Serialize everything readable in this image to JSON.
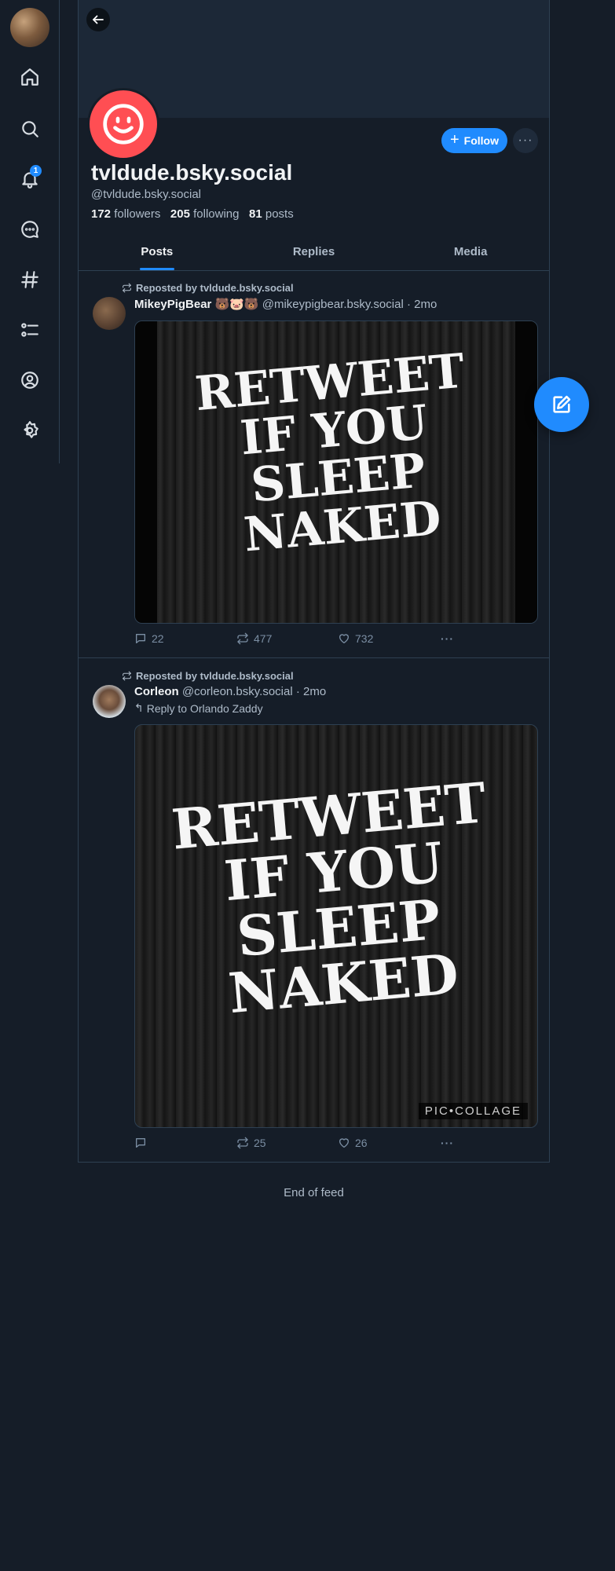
{
  "colors": {
    "background": "#151d28",
    "accent": "#208bfe",
    "avatar": "#ff4e53",
    "border": "#2e4052"
  },
  "nav": {
    "items": [
      {
        "icon": "home-icon"
      },
      {
        "icon": "search-icon"
      },
      {
        "icon": "notifications-icon",
        "badge": "1"
      },
      {
        "icon": "chat-icon"
      },
      {
        "icon": "feeds-hash-icon"
      },
      {
        "icon": "lists-icon"
      },
      {
        "icon": "profile-icon"
      },
      {
        "icon": "settings-icon"
      }
    ]
  },
  "profile": {
    "display_name": "tvldude.bsky.social",
    "handle": "@tvldude.bsky.social",
    "followers_count": "172",
    "followers_label": "followers",
    "following_count": "205",
    "following_label": "following",
    "posts_count": "81",
    "posts_label": "posts",
    "follow_label": "Follow",
    "more_label": "···"
  },
  "tabs": [
    {
      "label": "Posts",
      "active": true
    },
    {
      "label": "Replies",
      "active": false
    },
    {
      "label": "Media",
      "active": false
    }
  ],
  "posts": [
    {
      "repost_label": "Reposted by tvldude.bsky.social",
      "author": "MikeyPigBear 🐻🐷🐻",
      "handle": "@mikeypigbear.bsky.social",
      "time": "2mo",
      "image_text": [
        "RETWEET",
        "IF YOU",
        "SLEEP",
        "NAKED"
      ],
      "replies": "22",
      "reposts": "477",
      "likes": "732"
    },
    {
      "repost_label": "Reposted by tvldude.bsky.social",
      "author": "Corleon",
      "handle": "@corleon.bsky.social",
      "time": "2mo",
      "reply_to": "Reply to Orlando Zaddy",
      "image_text": [
        "RETWEET",
        "IF YOU",
        "SLEEP",
        "NAKED"
      ],
      "watermark": "PIC•COLLAGE",
      "replies": "",
      "reposts": "25",
      "likes": "26"
    }
  ],
  "feed_end": "End of feed"
}
